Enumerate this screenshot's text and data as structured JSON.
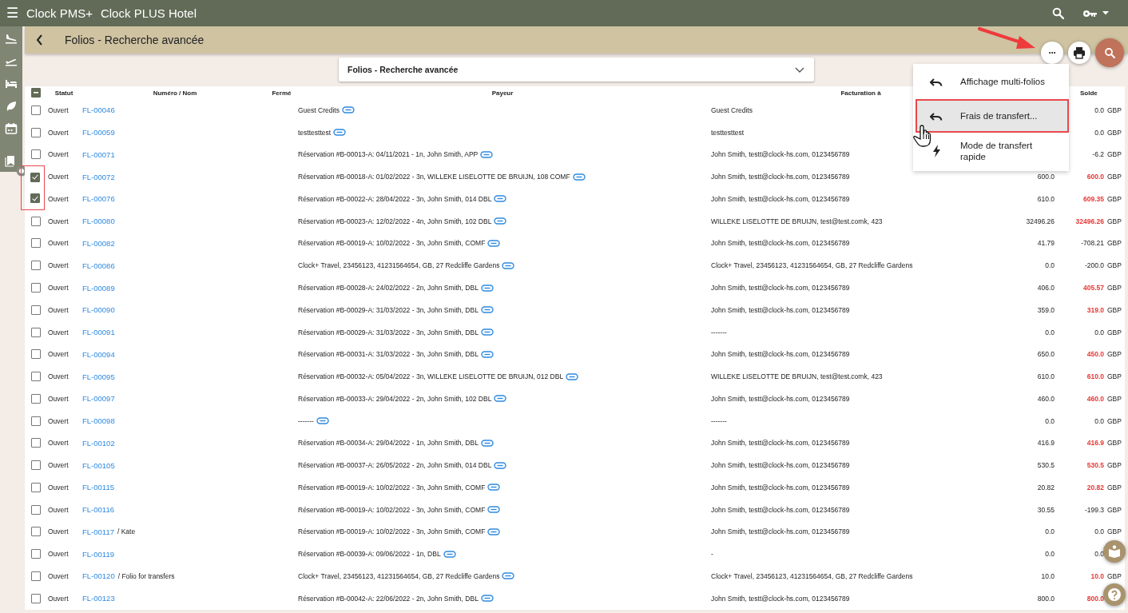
{
  "app_bar": {
    "menu": "☰",
    "app_name": "Clock PMS+",
    "hotel_name": "Clock PLUS Hotel"
  },
  "page_header": {
    "title": "Folios - Recherche avancée"
  },
  "toolbar": {
    "more_button": {
      "label": "···",
      "arrow_annotation": true
    }
  },
  "search_panel": {
    "title": "Folios - Recherche avancée",
    "expanded": false
  },
  "menu": {
    "items": [
      {
        "label": "Affichage multi-folios",
        "kind": "undo",
        "selected": false,
        "outlined": false
      },
      {
        "label": "Frais de transfert...",
        "kind": "undo",
        "selected": true,
        "outlined": true
      },
      {
        "label": "Mode de transfert rapide",
        "kind": "bolt",
        "selected": false,
        "outlined": false
      }
    ]
  },
  "table": {
    "select_all": {
      "indeterminate": true
    },
    "columns": [
      "Statut",
      "Numéro / Nom",
      "Fermé",
      "Payeur",
      "Facturation à",
      "Solde"
    ],
    "rows": [
      {
        "selected": false,
        "outlined": false,
        "status": "Ouvert",
        "number": "FL-00046",
        "payer": "Guest Credits",
        "billing": "Guest Credits",
        "balance": "0.0",
        "due": false,
        "currency": "GBP"
      },
      {
        "selected": false,
        "outlined": false,
        "status": "Ouvert",
        "number": "FL-00059",
        "payer": "testtesttest",
        "billing": "testtesttest",
        "balance": "0.0",
        "due": false,
        "currency": "GBP"
      },
      {
        "selected": false,
        "outlined": false,
        "status": "Ouvert",
        "number": "FL-00071",
        "payer": "Réservation #B-00013-A: 04/11/2021 - 1n, John Smith, APP",
        "billing": "John Smith, testt@clock-hs.com, 0123456789",
        "balance": "-6.2",
        "due": false,
        "currency": "GBP"
      },
      {
        "selected": true,
        "outlined": true,
        "status": "Ouvert",
        "number": "FL-00072",
        "payer": "Réservation #B-00018-A: 01/02/2022 - 3n, WILLEKE LISELOTTE DE BRUIJN, 108 COMF",
        "billing": "John Smith, testt@clock-hs.com, 0123456789",
        "column_6": "600.0",
        "balance": "600.0",
        "due": true,
        "currency": "GBP"
      },
      {
        "selected": true,
        "outlined": true,
        "status": "Ouvert",
        "number": "FL-00076",
        "payer": "Réservation #B-00022-A: 28/04/2022 - 3n, John Smith, 014 DBL",
        "billing": "John Smith, testt@clock-hs.com, 0123456789",
        "column_6": "610.0",
        "balance": "609.35",
        "due": true,
        "currency": "GBP"
      },
      {
        "selected": false,
        "outlined": false,
        "status": "Ouvert",
        "number": "FL-00080",
        "payer": "Réservation #B-00023-A: 12/02/2022 - 4n, John Smith, 102 DBL",
        "billing": "WILLEKE LISELOTTE DE BRUIJN, test@test.comk, 423",
        "column_6": "32496.26",
        "balance": "32496.26",
        "due": true,
        "currency": "GBP"
      },
      {
        "selected": false,
        "outlined": false,
        "status": "Ouvert",
        "number": "FL-00082",
        "payer": "Réservation #B-00019-A: 10/02/2022 - 3n, John Smith, COMF",
        "billing": "John Smith, testt@clock-hs.com, 0123456789",
        "column_6": "41.79",
        "balance": "-708.21",
        "due": false,
        "currency": "GBP"
      },
      {
        "selected": false,
        "outlined": false,
        "status": "Ouvert",
        "number": "FL-00086",
        "payer": "Clock+ Travel, 23456123, 41231564654, GB, 27 Redcliffe Gardens",
        "billing": "Clock+ Travel, 23456123, 41231564654, GB, 27 Redcliffe Gardens",
        "column_6": "0.0",
        "balance": "-200.0",
        "due": false,
        "currency": "GBP"
      },
      {
        "selected": false,
        "outlined": false,
        "status": "Ouvert",
        "number": "FL-00089",
        "payer": "Réservation #B-00028-A: 24/02/2022 - 2n, John Smith, DBL",
        "billing": "John Smith, testt@clock-hs.com, 0123456789",
        "column_6": "406.0",
        "balance": "405.57",
        "due": true,
        "currency": "GBP"
      },
      {
        "selected": false,
        "outlined": false,
        "status": "Ouvert",
        "number": "FL-00090",
        "payer": "Réservation #B-00029-A: 31/03/2022 - 3n, John Smith, DBL",
        "billing": "John Smith, testt@clock-hs.com, 0123456789",
        "column_6": "359.0",
        "balance": "319.0",
        "due": true,
        "currency": "GBP"
      },
      {
        "selected": false,
        "outlined": false,
        "status": "Ouvert",
        "number": "FL-00091",
        "payer": "Réservation #B-00029-A: 31/03/2022 - 3n, John Smith, DBL",
        "billing": "-------",
        "column_6": "0.0",
        "balance": "0.0",
        "due": false,
        "currency": "GBP"
      },
      {
        "selected": false,
        "outlined": false,
        "status": "Ouvert",
        "number": "FL-00094",
        "payer": "Réservation #B-00031-A: 31/03/2022 - 3n, John Smith, DBL",
        "billing": "John Smith, testt@clock-hs.com, 0123456789",
        "column_6": "650.0",
        "balance": "450.0",
        "due": true,
        "currency": "GBP"
      },
      {
        "selected": false,
        "outlined": false,
        "status": "Ouvert",
        "number": "FL-00095",
        "payer": "Réservation #B-00032-A: 05/04/2022 - 3n, WILLEKE LISELOTTE DE BRUIJN, 012 DBL",
        "billing": "WILLEKE LISELOTTE DE BRUIJN, test@test.comk, 423",
        "column_6": "610.0",
        "balance": "610.0",
        "due": true,
        "currency": "GBP"
      },
      {
        "selected": false,
        "outlined": false,
        "status": "Ouvert",
        "number": "FL-00097",
        "payer": "Réservation #B-00033-A: 29/04/2022 - 2n, John Smith, 102 DBL",
        "billing": "John Smith, testt@clock-hs.com, 0123456789",
        "column_6": "460.0",
        "balance": "460.0",
        "due": true,
        "currency": "GBP"
      },
      {
        "selected": false,
        "outlined": false,
        "status": "Ouvert",
        "number": "FL-00098",
        "payer": "-------",
        "billing": "-------",
        "column_6": "0.0",
        "balance": "0.0",
        "due": false,
        "currency": "GBP"
      },
      {
        "selected": false,
        "outlined": false,
        "status": "Ouvert",
        "number": "FL-00102",
        "payer": "Réservation #B-00034-A: 29/04/2022 - 1n, John Smith, DBL",
        "billing": "John Smith, testt@clock-hs.com, 0123456789",
        "column_6": "416.9",
        "balance": "416.9",
        "due": true,
        "currency": "GBP"
      },
      {
        "selected": false,
        "outlined": false,
        "status": "Ouvert",
        "number": "FL-00105",
        "payer": "Réservation #B-00037-A: 26/05/2022 - 2n, John Smith, 014 DBL",
        "billing": "John Smith, testt@clock-hs.com, 0123456789",
        "column_6": "530.5",
        "balance": "530.5",
        "due": true,
        "currency": "GBP"
      },
      {
        "selected": false,
        "outlined": false,
        "status": "Ouvert",
        "number": "FL-00115",
        "payer": "Réservation #B-00019-A: 10/02/2022 - 3n, John Smith, COMF",
        "billing": "John Smith, testt@clock-hs.com, 0123456789",
        "column_6": "20.82",
        "balance": "20.82",
        "due": true,
        "currency": "GBP"
      },
      {
        "selected": false,
        "outlined": false,
        "status": "Ouvert",
        "number": "FL-00116",
        "payer": "Réservation #B-00019-A: 10/02/2022 - 3n, John Smith, COMF",
        "billing": "John Smith, testt@clock-hs.com, 0123456789",
        "column_6": "30.55",
        "balance": "-199.3",
        "due": false,
        "currency": "GBP"
      },
      {
        "selected": false,
        "outlined": false,
        "status": "Ouvert",
        "number": "FL-00117",
        "name": "/ Kate",
        "payer": "Réservation #B-00019-A: 10/02/2022 - 3n, John Smith, COMF",
        "billing": "John Smith, testt@clock-hs.com, 0123456789",
        "column_6": "0.0",
        "balance": "0.0",
        "due": false,
        "currency": "GBP"
      },
      {
        "selected": false,
        "outlined": false,
        "status": "Ouvert",
        "number": "FL-00119",
        "payer": "Réservation #B-00039-A: 09/06/2022 - 1n, DBL",
        "billing": "-",
        "column_6": "0.0",
        "balance": "0.0",
        "due": false
      },
      {
        "selected": false,
        "outlined": false,
        "status": "Ouvert",
        "number": "FL-00120",
        "name": "/ Folio for transfers",
        "payer": "Clock+ Travel, 23456123, 41231564654, GB, 27 Redcliffe Gardens",
        "billing": "Clock+ Travel, 23456123, 41231564654, GB, 27 Redcliffe Gardens",
        "column_6": "10.0",
        "balance": "10.0",
        "due": true,
        "currency": "GBP"
      },
      {
        "selected": false,
        "outlined": false,
        "status": "Ouvert",
        "number": "FL-00123",
        "payer": "Réservation #B-00042-A: 22/06/2022 - 2n, John Smith, DBL",
        "billing": "John Smith, testt@clock-hs.com, 0123456789",
        "column_6": "800.0",
        "balance": "800.0",
        "due": true
      }
    ]
  }
}
